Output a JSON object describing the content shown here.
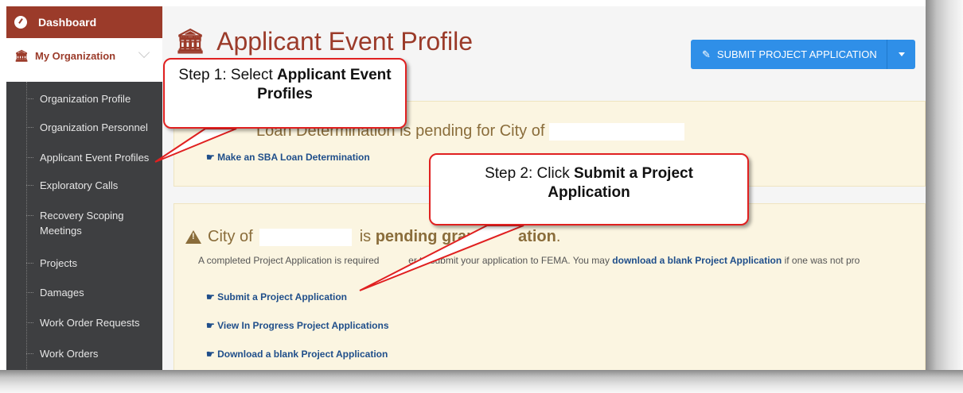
{
  "sidebar": {
    "dashboard": "Dashboard",
    "organization": "My Organization",
    "items": [
      {
        "label": "Organization Profile"
      },
      {
        "label": "Organization Personnel"
      },
      {
        "label": "Applicant Event Profiles"
      },
      {
        "label": "Exploratory Calls"
      },
      {
        "label": "Recovery Scoping Meetings"
      },
      {
        "label": "Projects"
      },
      {
        "label": "Damages"
      },
      {
        "label": "Work Order Requests"
      },
      {
        "label": "Work Orders"
      }
    ]
  },
  "header": {
    "title": "Applicant Event Profile",
    "submit_button": "SUBMIT PROJECT APPLICATION"
  },
  "panel1": {
    "message_end": "Loan Determination is pending for City of",
    "link": "Make an SBA Loan Determination"
  },
  "panel2": {
    "title_prefix": "City of",
    "title_middle": "is",
    "title_bold": "pending grant",
    "title_end": "ation",
    "title_period": ".",
    "desc_start": "A completed Project Application is required",
    "desc_mid": "er to submit your application to FEMA. You may",
    "desc_link": "download a blank Project Application",
    "desc_end": "if one was not pro",
    "links": [
      "Submit a Project Application",
      "View In Progress Project Applications",
      "Download a blank Project Application"
    ]
  },
  "callouts": {
    "step1_prefix": "Step 1: Select",
    "step1_bold": "Applicant Event Profiles",
    "step2_prefix": "Step 2: Click",
    "step2_bold": "Submit a Project Application"
  },
  "colors": {
    "brand": "#9b3b2a",
    "sidebar_bg": "#3e3f41",
    "primary_button": "#2f8fe8",
    "alert_bg": "#fbf5e1",
    "alert_text": "#8a6d3b",
    "callout_border": "#e02020"
  }
}
